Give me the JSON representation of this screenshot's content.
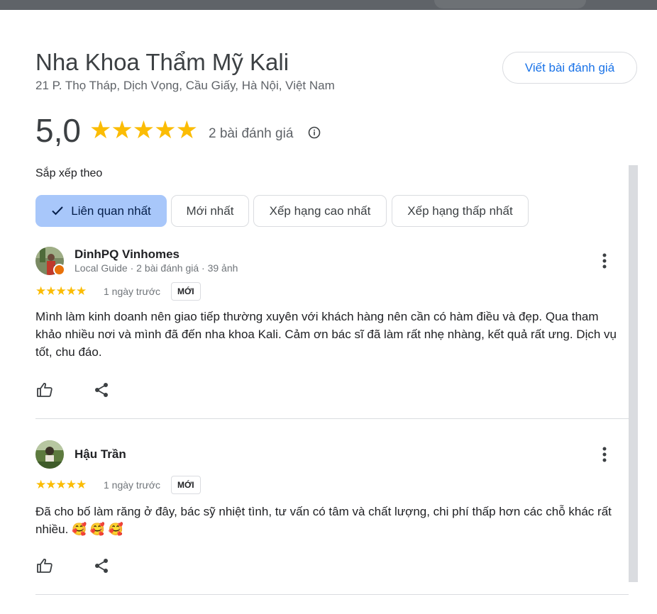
{
  "place": {
    "name": "Nha Khoa Thẩm Mỹ Kali",
    "address": "21 P. Thọ Tháp, Dịch Vọng, Cầu Giấy, Hà Nội, Việt Nam",
    "write_review_label": "Viết bài đánh giá",
    "rating": "5,0",
    "rating_stars": 5,
    "review_count": "2 bài đánh giá"
  },
  "sort": {
    "label": "Sắp xếp theo",
    "options": [
      "Liên quan nhất",
      "Mới nhất",
      "Xếp hạng cao nhất",
      "Xếp hạng thấp nhất"
    ],
    "selected": "Liên quan nhất"
  },
  "reviews": [
    {
      "name": "DinhPQ Vinhomes",
      "meta": "Local Guide · 2 bài đánh giá · 39 ảnh",
      "stars": 5,
      "time": "1 ngày trước",
      "badge": "MỚI",
      "text": "Mình làm kinh doanh nên giao tiếp thường xuyên với khách hàng nên cần có hàm điều và đẹp. Qua tham khảo nhiều nơi và mình đã đến nha khoa Kali. Cảm ơn bác sĩ đã làm rất nhẹ nhàng, kết quả rất ưng. Dịch vụ tốt, chu đáo."
    },
    {
      "name": "Hậu Trần",
      "meta": "",
      "stars": 5,
      "time": "1 ngày trước",
      "badge": "MỚI",
      "text": "Đã cho bố làm răng ở đây, bác sỹ nhiệt tình, tư vấn có tâm và chất lượng, chi phí thấp hơn các chỗ khác rất nhiều. 🥰 🥰 🥰"
    }
  ],
  "icons": {
    "star": "★",
    "info": "info-icon",
    "more": "more-vert-icon",
    "like": "thumb-up-icon",
    "share": "share-icon",
    "check": "check-icon"
  },
  "colors": {
    "star": "#fbbc04",
    "accent": "#1a73e8",
    "chip_selected": "#a8c7fa",
    "guide_badge": "#e8710a"
  }
}
